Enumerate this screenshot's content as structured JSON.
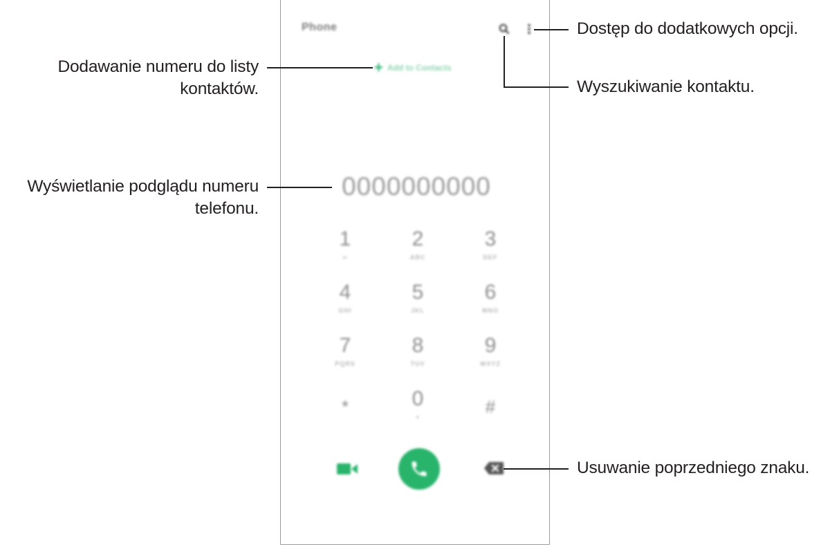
{
  "phone": {
    "app_title": "Phone",
    "add_contact_label": "Add to Contacts",
    "number_display": "0000000000",
    "keypad": [
      {
        "digit": "1",
        "letters": "∞"
      },
      {
        "digit": "2",
        "letters": "ABC"
      },
      {
        "digit": "3",
        "letters": "DEF"
      },
      {
        "digit": "4",
        "letters": "GHI"
      },
      {
        "digit": "5",
        "letters": "JKL"
      },
      {
        "digit": "6",
        "letters": "MNO"
      },
      {
        "digit": "7",
        "letters": "PQRS"
      },
      {
        "digit": "8",
        "letters": "TUV"
      },
      {
        "digit": "9",
        "letters": "WXYZ"
      },
      {
        "digit": "*",
        "letters": ""
      },
      {
        "digit": "0",
        "letters": "+"
      },
      {
        "digit": "#",
        "letters": ""
      }
    ],
    "icons": {
      "search": "search-icon",
      "more": "more-options-icon",
      "video": "video-call-icon",
      "call": "phone-call-icon",
      "backspace": "backspace-icon",
      "add": "plus-icon"
    },
    "colors": {
      "accent_green": "#29b46c",
      "add_label_green": "#8fd6b3",
      "leader_line": "#231f20"
    }
  },
  "annotations": {
    "more_options": "Dostęp do dodatkowych opcji.",
    "search_contact": "Wyszukiwanie kontaktu.",
    "add_number_line1": "Dodawanie numeru do listy",
    "add_number_line2": "kontaktów.",
    "preview_number_line1": "Wyświetlanie podglądu numeru",
    "preview_number_line2": "telefonu.",
    "delete_char": "Usuwanie poprzedniego znaku."
  }
}
